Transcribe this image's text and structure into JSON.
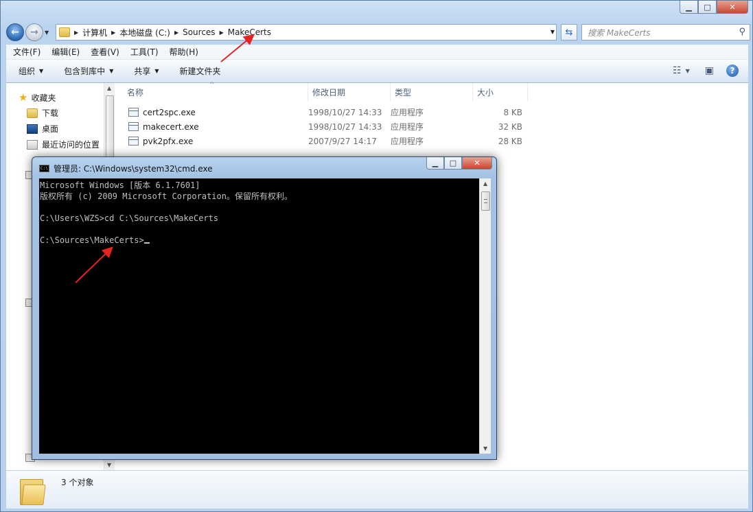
{
  "explorer": {
    "breadcrumb": [
      "计算机",
      "本地磁盘 (C:)",
      "Sources",
      "MakeCerts"
    ],
    "search_placeholder": "搜索 MakeCerts",
    "menu": [
      "文件(F)",
      "编辑(E)",
      "查看(V)",
      "工具(T)",
      "帮助(H)"
    ],
    "toolbar": {
      "organize": "组织",
      "include_library": "包含到库中",
      "share": "共享",
      "new_folder": "新建文件夹"
    },
    "nav": {
      "favorites": "收藏夹",
      "downloads": "下载",
      "desktop": "桌面",
      "recent": "最近访问的位置"
    },
    "columns": {
      "name": "名称",
      "date": "修改日期",
      "type": "类型",
      "size": "大小"
    },
    "files": [
      {
        "name": "cert2spc.exe",
        "date": "1998/10/27 14:33",
        "type": "应用程序",
        "size": "8 KB"
      },
      {
        "name": "makecert.exe",
        "date": "1998/10/27 14:33",
        "type": "应用程序",
        "size": "32 KB"
      },
      {
        "name": "pvk2pfx.exe",
        "date": "2007/9/27 14:17",
        "type": "应用程序",
        "size": "28 KB"
      }
    ],
    "status_count": "3 个对象"
  },
  "cmd": {
    "title": "管理员: C:\\Windows\\system32\\cmd.exe",
    "lines": [
      "Microsoft Windows [版本 6.1.7601]",
      "版权所有 (c) 2009 Microsoft Corporation。保留所有权利。",
      "",
      "C:\\Users\\WZS>cd C:\\Sources\\MakeCerts",
      "",
      "C:\\Sources\\MakeCerts>"
    ]
  },
  "colors": {
    "annotation_arrow": "#e8231f",
    "console_bg": "#000000",
    "console_fg": "#c0c0c0"
  }
}
